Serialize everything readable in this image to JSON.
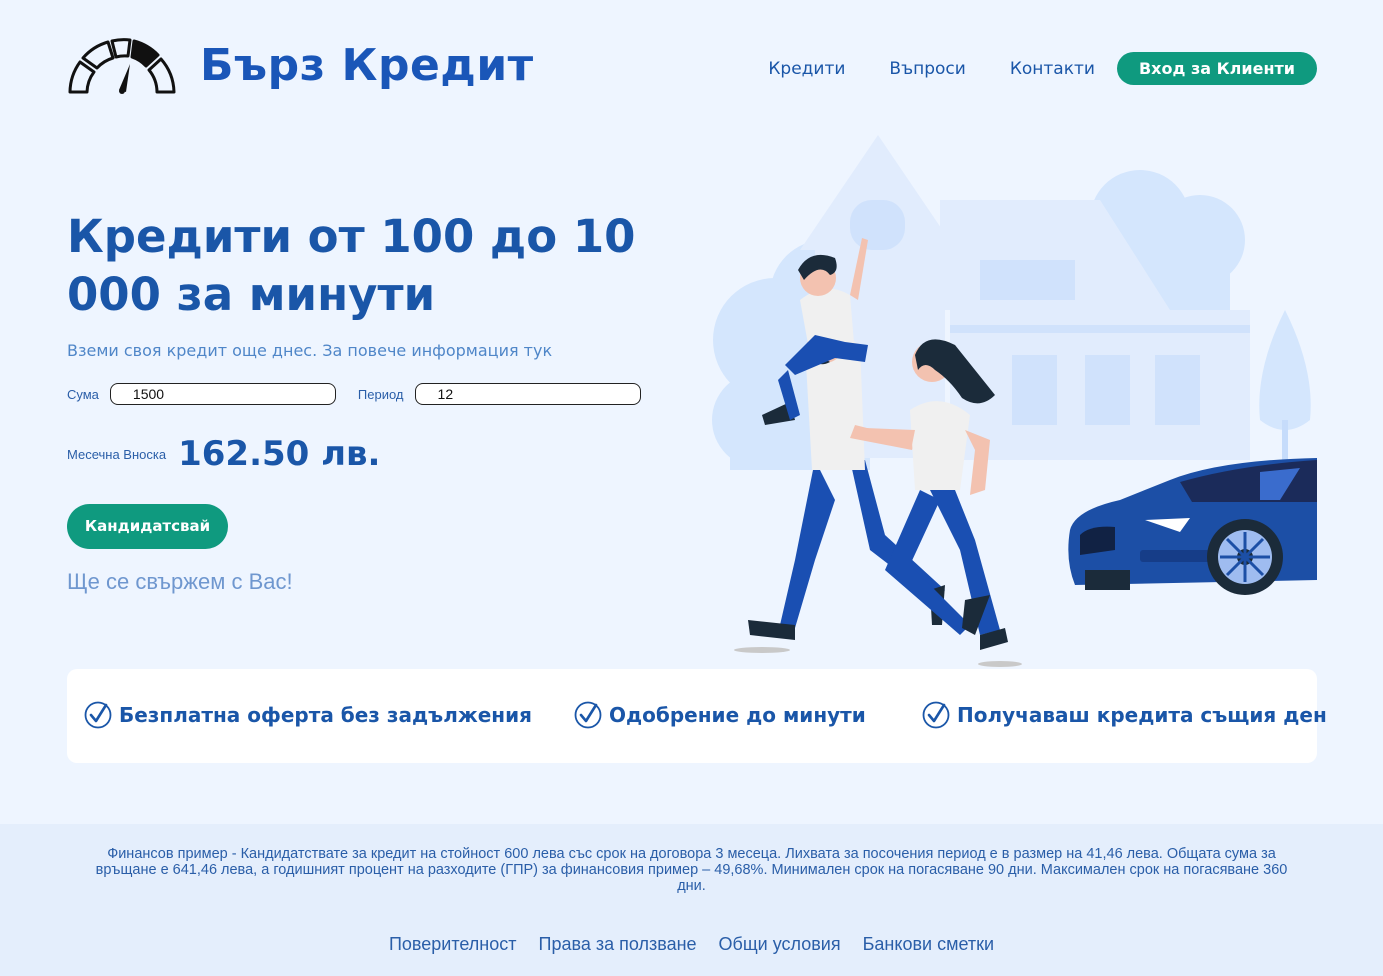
{
  "brand": {
    "name": "Бърз Кредит",
    "icon": "speedometer-icon"
  },
  "nav": {
    "items": [
      {
        "label": "Кредити"
      },
      {
        "label": "Въпроси"
      },
      {
        "label": "Контакти"
      }
    ],
    "login_label": "Вход за Клиенти"
  },
  "hero": {
    "title": "Кредити от 100 до 10 000 за минути",
    "subtitle": "Вземи своя кредит още днес. За повече информация тук"
  },
  "calculator": {
    "sum_label": "Сума",
    "sum_value": "1500",
    "period_label": "Период",
    "period_value": "12",
    "monthly_label": "Месечна Вноска",
    "monthly_value": "162.50 лв."
  },
  "apply": {
    "label": "Кандидатсвай",
    "note": "Ще се свържем с Вас!"
  },
  "features": [
    {
      "icon": "check-circle-icon",
      "label": "Безплатна оферта без задължения"
    },
    {
      "icon": "check-circle-icon",
      "label": "Одобрение до минути"
    },
    {
      "icon": "check-circle-icon",
      "label": "Получаваш кредита същия ден"
    }
  ],
  "footer": {
    "finance_example": "Финансов пример - Кандидатствате за кредит на стойност 600 лева със срок на договора 3 месеца. Лихвата за посочения период е в размер на 41,46 лева. Общата сума за връщане е 641,46 лева, а годишният процент на разходите (ГПР) за финансовия пример – 49,68%. Минимален срок на погасяване 90 дни. Максимален срок на погасяване 360 дни.",
    "links": [
      {
        "label": "Поверителност"
      },
      {
        "label": "Права за ползване"
      },
      {
        "label": "Общи условия"
      },
      {
        "label": "Банкови сметки"
      }
    ]
  },
  "colors": {
    "background": "#eef5ff",
    "primary_blue": "#1a56a8",
    "accent_green": "#0f9a7f",
    "footer_bg": "#e4eefc"
  }
}
